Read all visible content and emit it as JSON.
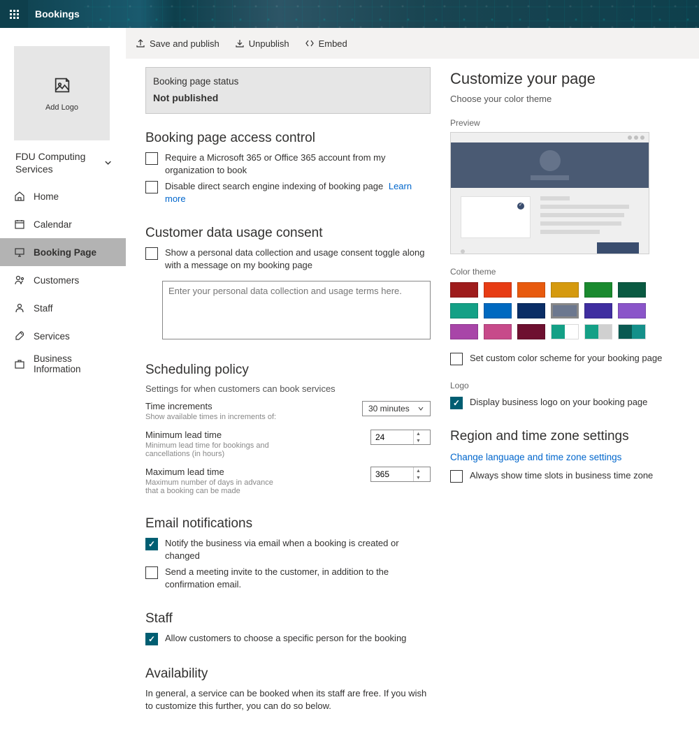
{
  "header": {
    "app_name": "Bookings"
  },
  "sidebar": {
    "logo_text": "Add Logo",
    "org_name": "FDU Computing Services",
    "nav": [
      {
        "label": "Home"
      },
      {
        "label": "Calendar"
      },
      {
        "label": "Booking Page"
      },
      {
        "label": "Customers"
      },
      {
        "label": "Staff"
      },
      {
        "label": "Services"
      },
      {
        "label": "Business Information"
      }
    ]
  },
  "toolbar": {
    "save": "Save and publish",
    "unpublish": "Unpublish",
    "embed": "Embed"
  },
  "status": {
    "label": "Booking page status",
    "value": "Not published"
  },
  "access_control": {
    "title": "Booking page access control",
    "opt_require": "Require a Microsoft 365 or Office 365 account from my organization to book",
    "opt_disable": "Disable direct search engine indexing of booking page",
    "learn_more": "Learn more"
  },
  "consent": {
    "title": "Customer data usage consent",
    "opt": "Show a personal data collection and usage consent toggle along with a message on my booking page",
    "placeholder": "Enter your personal data collection and usage terms here."
  },
  "scheduling": {
    "title": "Scheduling policy",
    "subtitle": "Settings for when customers can book services",
    "time_increments_label": "Time increments",
    "time_increments_hint": "Show available times in increments of:",
    "time_increments_value": "30 minutes",
    "min_lead_label": "Minimum lead time",
    "min_lead_hint": "Minimum lead time for bookings and cancellations (in hours)",
    "min_lead_value": "24",
    "max_lead_label": "Maximum lead time",
    "max_lead_hint": "Maximum number of days in advance that a booking can be made",
    "max_lead_value": "365"
  },
  "email": {
    "title": "Email notifications",
    "opt_notify": "Notify the business via email when a booking is created or changed",
    "opt_invite": "Send a meeting invite to the customer, in addition to the confirmation email."
  },
  "staff": {
    "title": "Staff",
    "opt": "Allow customers to choose a specific person for the booking"
  },
  "availability": {
    "title": "Availability",
    "text": "In general, a service can be booked when its staff are free. If you wish to customize this further, you can do so below."
  },
  "customize": {
    "title": "Customize your page",
    "subtitle": "Choose your color theme",
    "preview_label": "Preview",
    "color_theme_label": "Color theme",
    "custom_color_opt": "Set custom color scheme for your booking page",
    "logo_label": "Logo",
    "logo_opt": "Display business logo on your booking page",
    "region_title": "Region and time zone settings",
    "region_link": "Change language and time zone settings",
    "region_opt": "Always show time slots in business time zone",
    "colors": [
      "#9e1c1c",
      "#e73c14",
      "#e85a0e",
      "#d59a0f",
      "#1a8a2f",
      "#0a5a42",
      "#14a086",
      "#0069c0",
      "#0a2e66",
      "#6c788f",
      "#3f2ea0",
      "#8a55c9",
      "#a845a8",
      "#c74a8a",
      "#6e1030"
    ],
    "half_colors": [
      {
        "a": "#14a086",
        "b": "#ffffff"
      },
      {
        "a": "#14a086",
        "b": "#d0d0d0"
      },
      {
        "a": "#0a5a52",
        "b": "#14908a"
      }
    ],
    "selected_color_index": 9
  }
}
